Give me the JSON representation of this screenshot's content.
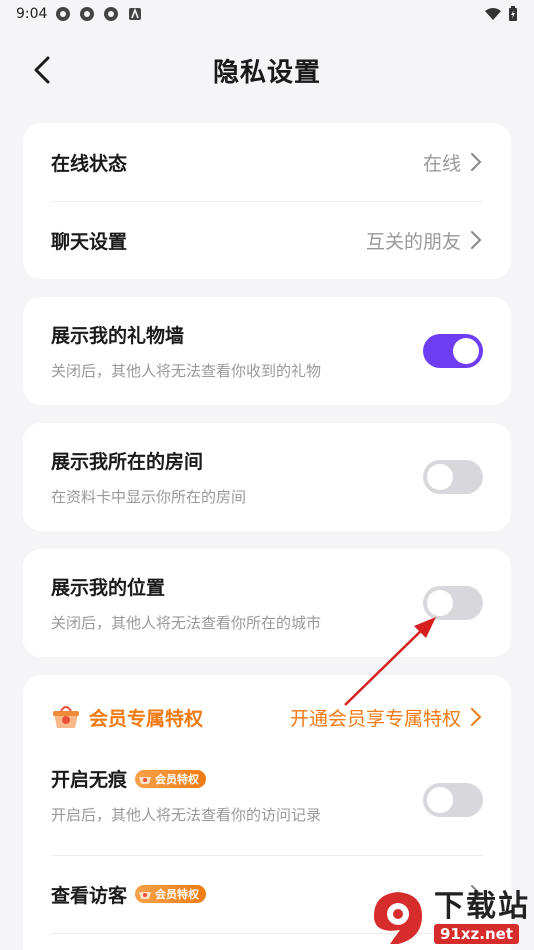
{
  "status_bar": {
    "time": "9:04"
  },
  "header": {
    "title": "隐私设置"
  },
  "card1": {
    "online_status": {
      "label": "在线状态",
      "value": "在线"
    },
    "chat_settings": {
      "label": "聊天设置",
      "value": "互关的朋友"
    }
  },
  "gift_wall": {
    "label": "展示我的礼物墙",
    "desc": "关闭后，其他人将无法查看你收到的礼物",
    "enabled": true
  },
  "room": {
    "label": "展示我所在的房间",
    "desc": "在资料卡中显示你所在的房间",
    "enabled": false
  },
  "location": {
    "label": "展示我的位置",
    "desc": "关闭后，其他人将无法查看你所在的城市",
    "enabled": false
  },
  "vip": {
    "title": "会员专属特权",
    "link": "开通会员享专属特权",
    "badge": "会员特权",
    "incognito": {
      "label": "开启无痕",
      "desc": "开启后，其他人将无法查看你的访问记录",
      "enabled": false
    },
    "visitors": {
      "label": "查看访客"
    }
  },
  "watermark": {
    "title": "下载站",
    "domain": "91xz.net"
  },
  "colors": {
    "accent": "#6e3df2",
    "vip": "#f07a13",
    "arrow": "#d62020"
  }
}
